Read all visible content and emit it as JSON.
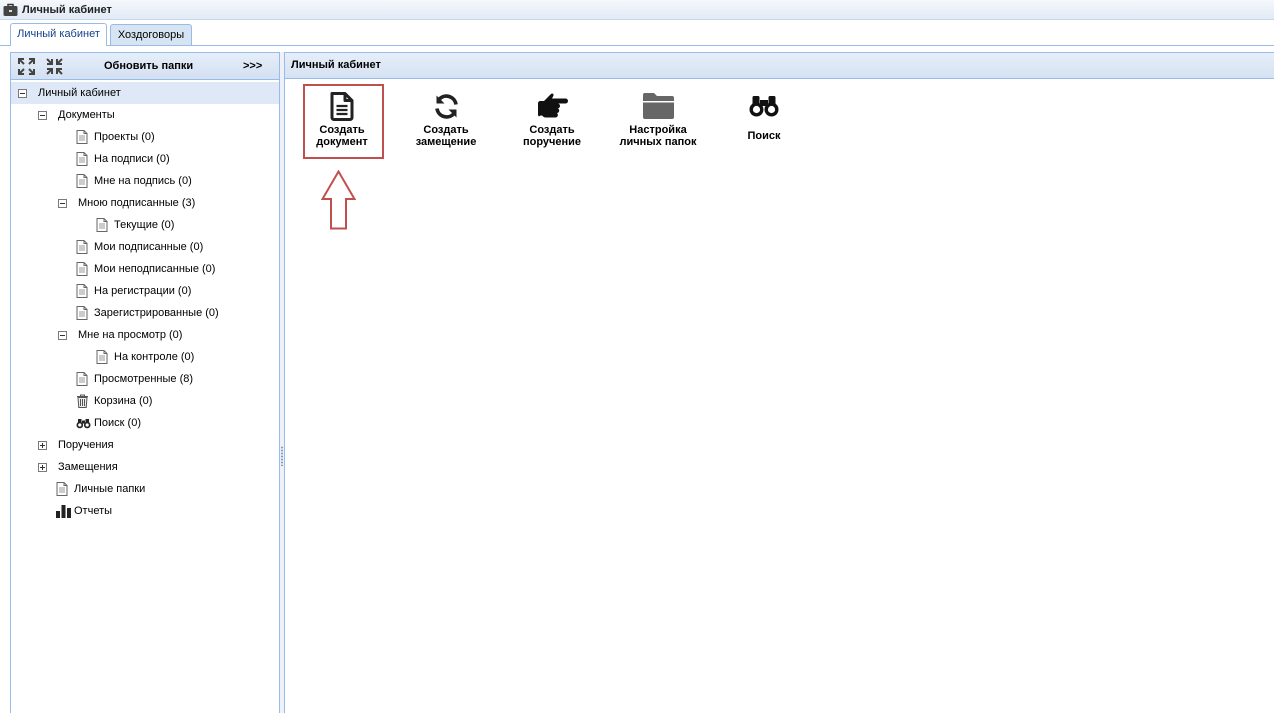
{
  "window": {
    "title": "Личный кабинет",
    "icon": "briefcase-icon"
  },
  "tabs": [
    {
      "label": "Личный кабинет",
      "active": true
    },
    {
      "label": "Хоздоговоры",
      "active": false
    }
  ],
  "left_panel": {
    "toolbar": {
      "expand_all_icon": "expand-all-icon",
      "collapse_all_icon": "collapse-all-icon",
      "refresh_label": "Обновить папки",
      "more_label": ">>>"
    },
    "tree": [
      {
        "label": "Личный кабинет",
        "depth": 0,
        "expanded": true,
        "selected": true
      },
      {
        "label": "Документы",
        "depth": 1,
        "expanded": true
      },
      {
        "label": "Проекты (0)",
        "depth": 2,
        "icon": "document-icon"
      },
      {
        "label": "На подписи (0)",
        "depth": 2,
        "icon": "document-icon"
      },
      {
        "label": "Мне на подпись (0)",
        "depth": 2,
        "icon": "document-icon"
      },
      {
        "label": "Мною подписанные (3)",
        "depth": 2,
        "expanded": true
      },
      {
        "label": "Текущие (0)",
        "depth": 3,
        "icon": "document-icon"
      },
      {
        "label": "Мои подписанные (0)",
        "depth": 2,
        "icon": "document-icon"
      },
      {
        "label": "Мои неподписанные (0)",
        "depth": 2,
        "icon": "document-icon"
      },
      {
        "label": "На регистрации (0)",
        "depth": 2,
        "icon": "document-icon"
      },
      {
        "label": "Зарегистрированные (0)",
        "depth": 2,
        "icon": "document-icon"
      },
      {
        "label": "Мне на просмотр (0)",
        "depth": 2,
        "expanded": true
      },
      {
        "label": "На контроле (0)",
        "depth": 3,
        "icon": "document-icon"
      },
      {
        "label": "Просмотренные (8)",
        "depth": 2,
        "icon": "document-icon"
      },
      {
        "label": "Корзина (0)",
        "depth": 2,
        "icon": "trash-icon"
      },
      {
        "label": "Поиск (0)",
        "depth": 2,
        "icon": "binoculars-icon"
      },
      {
        "label": "Поручения",
        "depth": 1,
        "expanded": false
      },
      {
        "label": "Замещения",
        "depth": 1,
        "expanded": false
      },
      {
        "label": "Личные папки",
        "depth": 1,
        "icon": "document-icon"
      },
      {
        "label": "Отчеты",
        "depth": 1,
        "icon": "bar-chart-icon"
      }
    ]
  },
  "main_panel": {
    "title": "Личный кабинет",
    "actions": [
      {
        "line1": "Создать",
        "line2": "документ",
        "icon": "document-icon",
        "highlighted": true
      },
      {
        "line1": "Создать",
        "line2": "замещение",
        "icon": "refresh-icon"
      },
      {
        "line1": "Создать",
        "line2": "поручение",
        "icon": "pointing-hand-icon"
      },
      {
        "line1": "Настройка",
        "line2": "личных папок",
        "icon": "folder-icon"
      },
      {
        "line1": "Поиск",
        "icon": "binoculars-icon"
      }
    ]
  },
  "colors": {
    "accent": "#15428b",
    "annotation": "#c0504d",
    "selection": "#dfe8f6",
    "border": "#99bbe8"
  }
}
